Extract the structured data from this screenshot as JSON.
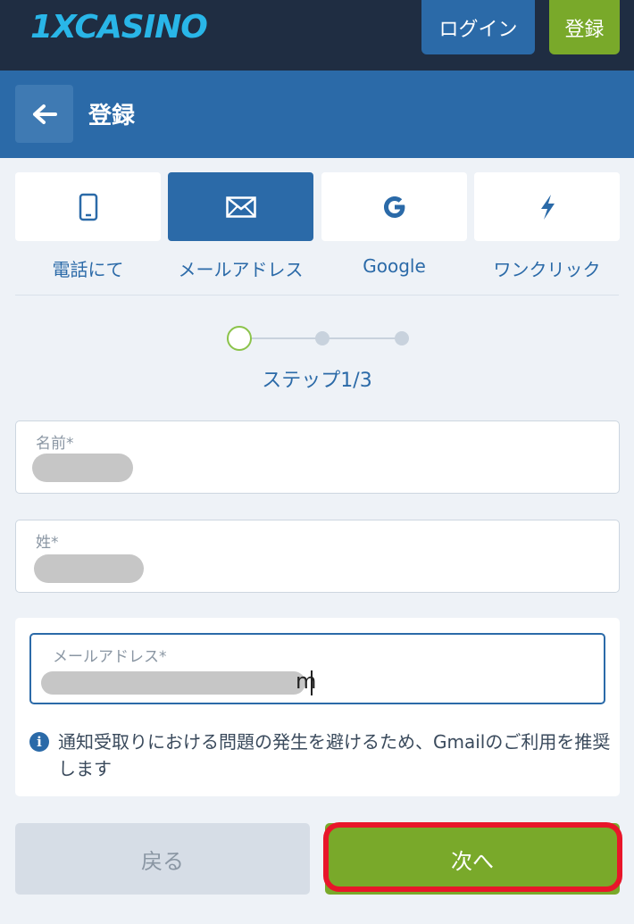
{
  "header": {
    "logo_text": "1XCASINO",
    "login_label": "ログイン",
    "register_label": "登録"
  },
  "titlebar": {
    "title": "登録",
    "back_icon": "arrow-left-icon"
  },
  "tabs": [
    {
      "label": "電話にて",
      "icon": "phone-icon",
      "active": false
    },
    {
      "label": "メールアドレス",
      "icon": "envelope-icon",
      "active": true
    },
    {
      "label": "Google",
      "icon": "google-icon",
      "active": false
    },
    {
      "label": "ワンクリック",
      "icon": "lightning-icon",
      "active": false
    }
  ],
  "stepper": {
    "text": "ステップ1/3",
    "current": 1,
    "total": 3
  },
  "form": {
    "first_name_label": "名前*",
    "last_name_label": "姓*",
    "email_label": "メールアドレス*",
    "email_visible_tail": "m",
    "info_text": "通知受取りにおける問題の発生を避けるため、Gmailのご利用を推奨します"
  },
  "buttons": {
    "back_label": "戻る",
    "next_label": "次へ"
  },
  "colors": {
    "header_bg": "#1f2d42",
    "primary": "#2b6aa8",
    "accent_green": "#79a92a",
    "highlight_red": "#e8162a"
  }
}
